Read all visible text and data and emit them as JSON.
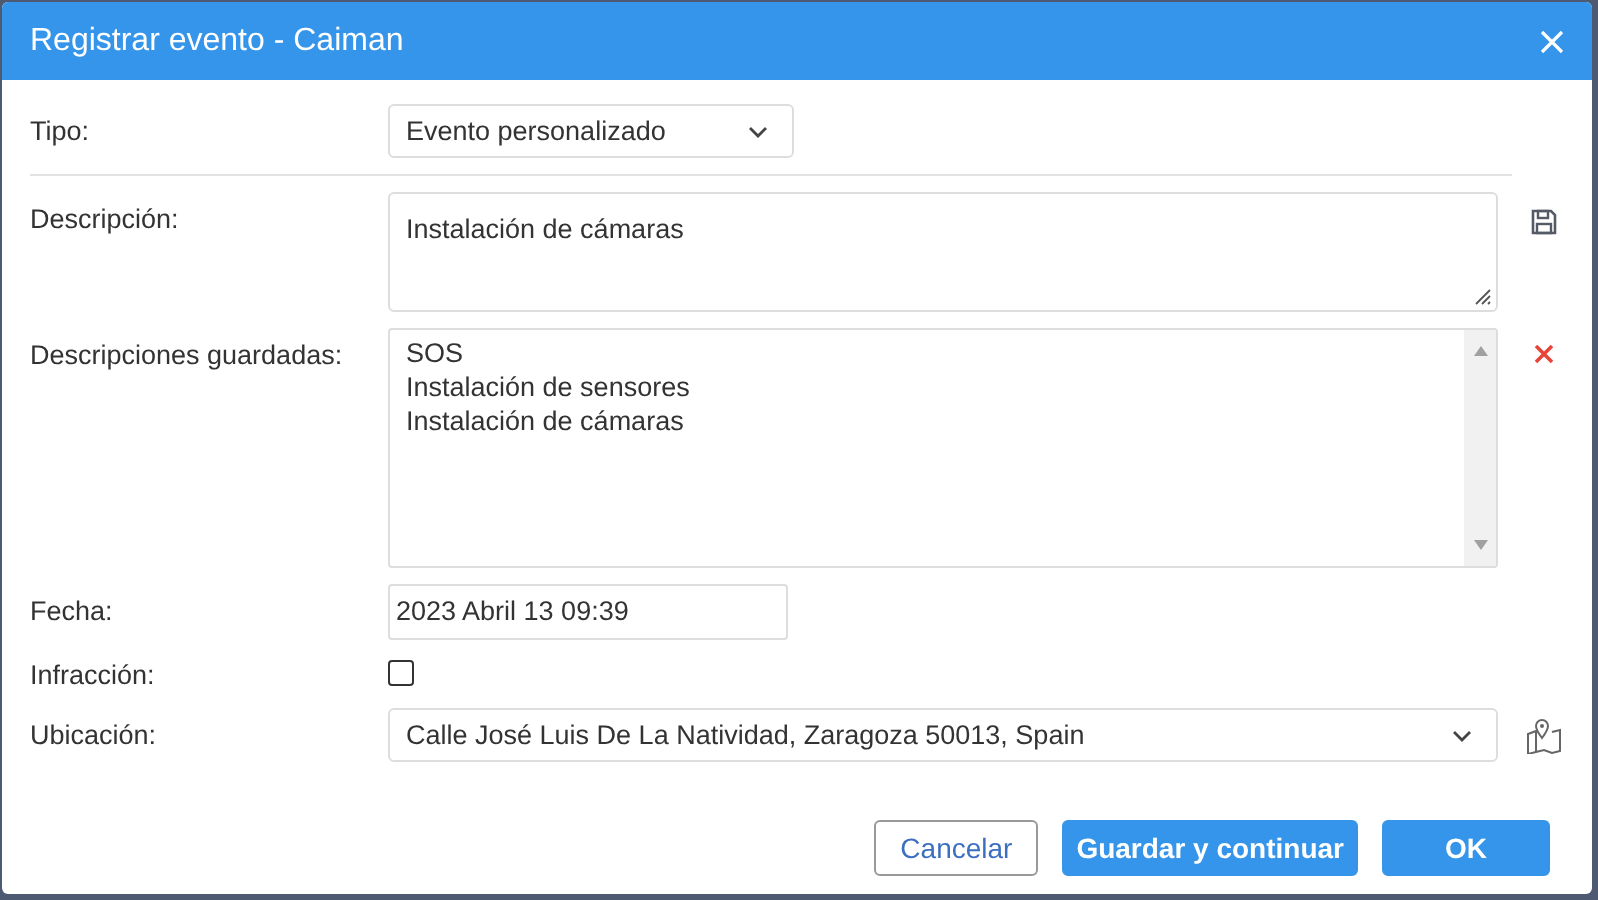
{
  "window": {
    "title": "Registrar evento - Caiman"
  },
  "fields": [
    {
      "kind": "select",
      "label": "Tipo:",
      "value": "Evento personalizado"
    },
    {
      "kind": "textarea",
      "label": "Descripción:",
      "value": "Instalación de cámaras"
    },
    {
      "kind": "list",
      "label": "Descripciones guardadas:",
      "items": [
        "SOS",
        "Instalación de sensores",
        "Instalación de cámaras"
      ]
    },
    {
      "kind": "date",
      "label": "Fecha:",
      "value": "2023 Abril 13 09:39"
    },
    {
      "kind": "checkbox",
      "label": "Infracción:",
      "checked": false
    },
    {
      "kind": "address",
      "label": "Ubicación:",
      "value": "Calle José Luis De La Natividad, Zaragoza 50013, Spain"
    }
  ],
  "buttons": [
    {
      "kind": "secondary",
      "label": "Cancelar"
    },
    {
      "kind": "primary",
      "label": "Guardar y continuar"
    },
    {
      "kind": "primary",
      "label": "OK"
    }
  ]
}
